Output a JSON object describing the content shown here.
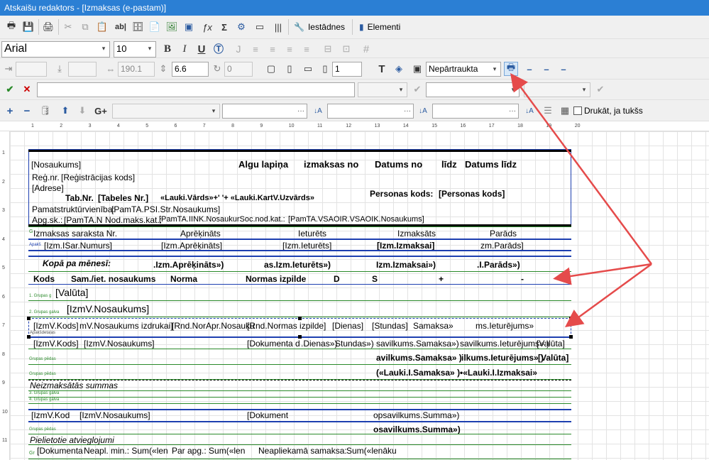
{
  "window": {
    "title": "Atskaišu redaktors - [Izmaksas (e-pastam)]"
  },
  "toolbar1": {
    "settings_label": "Iestādnes",
    "elements_label": "Elementi"
  },
  "toolbar2": {
    "font_family": "Arial",
    "font_size": "10"
  },
  "toolbar3": {
    "v1": "",
    "v2": "",
    "width": "190.1",
    "height": "6.6",
    "angle": "0",
    "border_width": "1",
    "line_style": "Nepārtraukta"
  },
  "toolbar5": {
    "print_if_empty_label": "Drukāt, ja tukšs"
  },
  "ruler": {
    "top": [
      "1",
      "2",
      "3",
      "4",
      "5",
      "6",
      "7",
      "8",
      "9",
      "10",
      "11",
      "12",
      "13",
      "14",
      "15",
      "16",
      "17",
      "18",
      "19",
      "20"
    ],
    "left": [
      "1",
      "2",
      "3",
      "4",
      "5",
      "6",
      "7",
      "8",
      "9",
      "10",
      "11"
    ]
  },
  "report": {
    "r1": {
      "nos": "[Nosaukums]",
      "algu": "Algu lapiņa",
      "izm": "izmaksas no",
      "dat": "Datums no",
      "lidz": "līdz",
      "datl": "Datums līdz"
    },
    "r2": {
      "reg": "Reģ.nr.",
      "regv": "[Reģistrācijas kods]"
    },
    "r3": {
      "adr": "[Adrese]"
    },
    "r4": {
      "tab": "Tab.Nr.",
      "tabv": "[Tabeles Nr.]",
      "vards": "«Lauki.Vārds»+' '+ «Lauki.KartV.Uzvārds»",
      "pers": "Personas kods:",
      "persv": "[Personas kods]"
    },
    "r5": {
      "pam": "Pamatstruktūrvienība:",
      "pamv": "[PamTA.PSI.Str.Nosaukums]"
    },
    "r6": {
      "apg": "Apg.sk.:",
      "apgv": "[PamTA.N",
      "nod": "Nod.maks.kat.:",
      "nodv": "[PamTA.IINK.NosaukurSoc.nod.kat.:",
      "vsa": "[PamTA.VSAOIR.VSAOIK.Nosaukums]"
    },
    "h1": {
      "g": "G",
      "sar": "Izmaksas saraksta Nr.",
      "apr": "Aprēķināts",
      "iet": "Ieturēts",
      "izmk": "Izmaksāts",
      "par": "Parāds"
    },
    "h2": {
      "tag": "Apakš",
      "sar": "[Izm.ISar.Numurs]",
      "apr": "[Izm.Aprēķināts]",
      "iet": "[Izm.Ieturēts]",
      "izmk": "[Izm.Izmaksai]",
      "par": "zm.Parāds]"
    },
    "h3": {
      "kopa": "Kopā pa mēnesī:",
      "apr": ".Izm.Aprēķināts»)",
      "iet": "as.Izm.Ieturēts»)",
      "izmk": "Izm.Izmaksai»)",
      "par": ".I.Parāds»)"
    },
    "h4": {
      "kods": "Kods",
      "nos": "Sam./iet. nosaukums",
      "norma": "Norma",
      "izp": "Normas izpilde",
      "d": "D",
      "s": "S",
      "plus": "+",
      "minus": "-"
    },
    "g1": {
      "tag": "1. Grupas g",
      "val": "[Valūta]"
    },
    "g2": {
      "tag": "2. Grupas galva",
      "val": "[IzmV.Nosaukums]"
    },
    "d1": {
      "kods": "[IzmV.Kods]",
      "nos": "mV.Nosaukums izdrukai]",
      "rnd": "[Rnd.NorApr.Nosauku",
      "rnd2": "[Rnd.Normas izpilde]",
      "dien": "[Dienas]",
      "stun": "[Stundas]",
      "sam": "Samaksa»",
      "iet": "ms.Ieturējums»",
      "tag": "Apakšdetaļas"
    },
    "d2": {
      "kods": "[IzmV.Kods]",
      "nos": "[IzmV.Nosaukums]",
      "dok": "[Dokumenta d",
      "dien": ".Dienas»)",
      "stun": "Stundas»)",
      "sam": "savilkums.Samaksa»)",
      "iet": "savilkums.Ieturējums» )",
      "val": "[Valūta]"
    },
    "f1": {
      "tag": "Grupas pēdas",
      "sam": "avilkums.Samaksa» )",
      "iet": "ilkums.Ieturējums» )",
      "val": "[Valūta]"
    },
    "f2": {
      "tag": "Grupas pēdas",
      "sam": "(«Lauki.I.Samaksa» )",
      "iet": "•«Lauki.I.Izmaksai»"
    },
    "n1": {
      "title": "Neizmaksātās summas"
    },
    "n2": {
      "tag3": "3. Grupas galva",
      "tag4": "4. Grupas galva"
    },
    "n3": {
      "kods": "[IzmV.Kod",
      "nos": "[IzmV.Nosaukums]",
      "dok": "[Dokument",
      "sum": "opsavilkums.Summa»)"
    },
    "n4": {
      "tag": "Grupas pēdas",
      "sum": "osavilkums.Summa»)"
    },
    "p1": {
      "title": "Pielietotie atvieglojumi"
    },
    "p2": {
      "tag": "Gr",
      "dok": "[Dokumenta",
      "nep": "Neapl. min.: Sum(«len",
      "par": "Par apg.: Sum(«len",
      "nepl": "Neapliekamā samaksa:",
      "sum": "Sum(«lenāku"
    }
  }
}
